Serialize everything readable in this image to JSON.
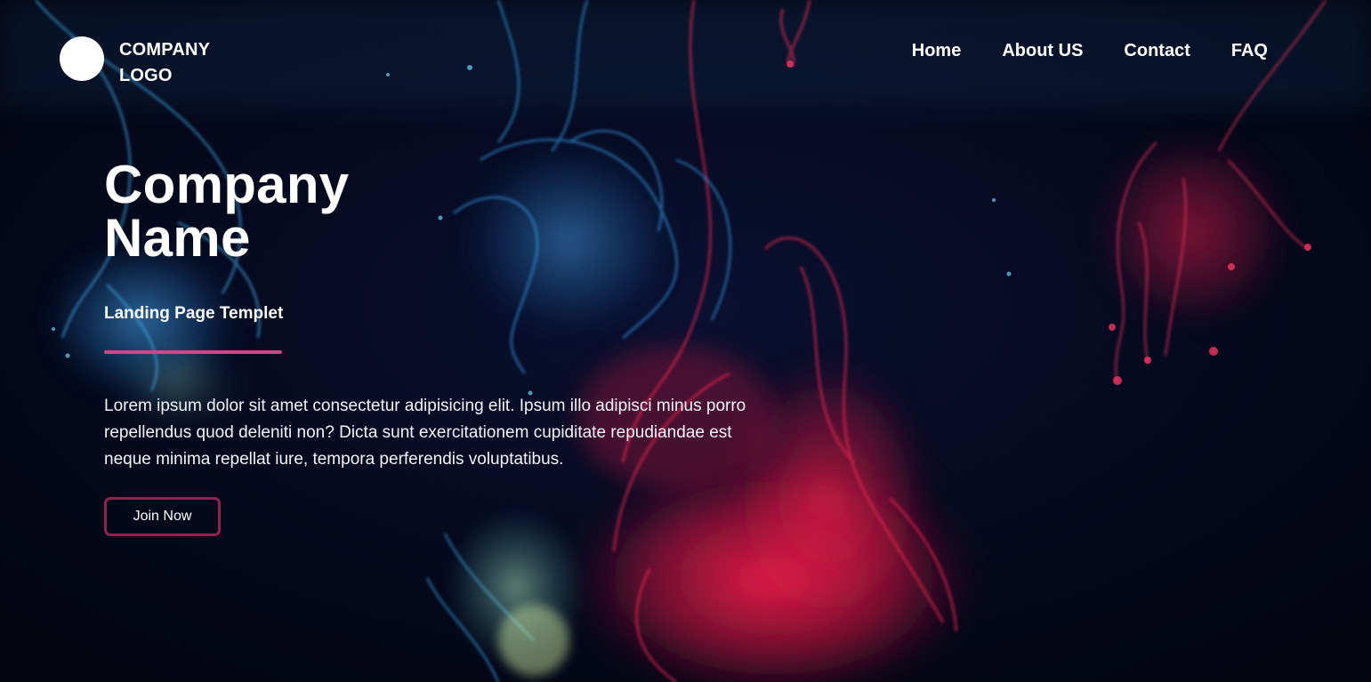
{
  "header": {
    "logo_text": "COMPANY LOGO",
    "nav": [
      {
        "label": "Home"
      },
      {
        "label": "About US"
      },
      {
        "label": "Contact"
      },
      {
        "label": "FAQ"
      }
    ]
  },
  "hero": {
    "title": "Company Name",
    "subtitle": "Landing Page Templet",
    "description": "Lorem ipsum dolor sit amet consectetur adipisicing elit. Ipsum illo adipisci minus porro repellendus quod deleniti non? Dicta sunt exercitationem cupiditate repudiandae est neque minima repellat iure, tempora perferendis voluptatibus.",
    "cta_label": "Join Now"
  },
  "colors": {
    "background": "#050822",
    "accent_bar": "#d2458a",
    "button_border": "#8e2450",
    "smoke_blue": "#2f8fd6",
    "smoke_red": "#e8204a"
  }
}
